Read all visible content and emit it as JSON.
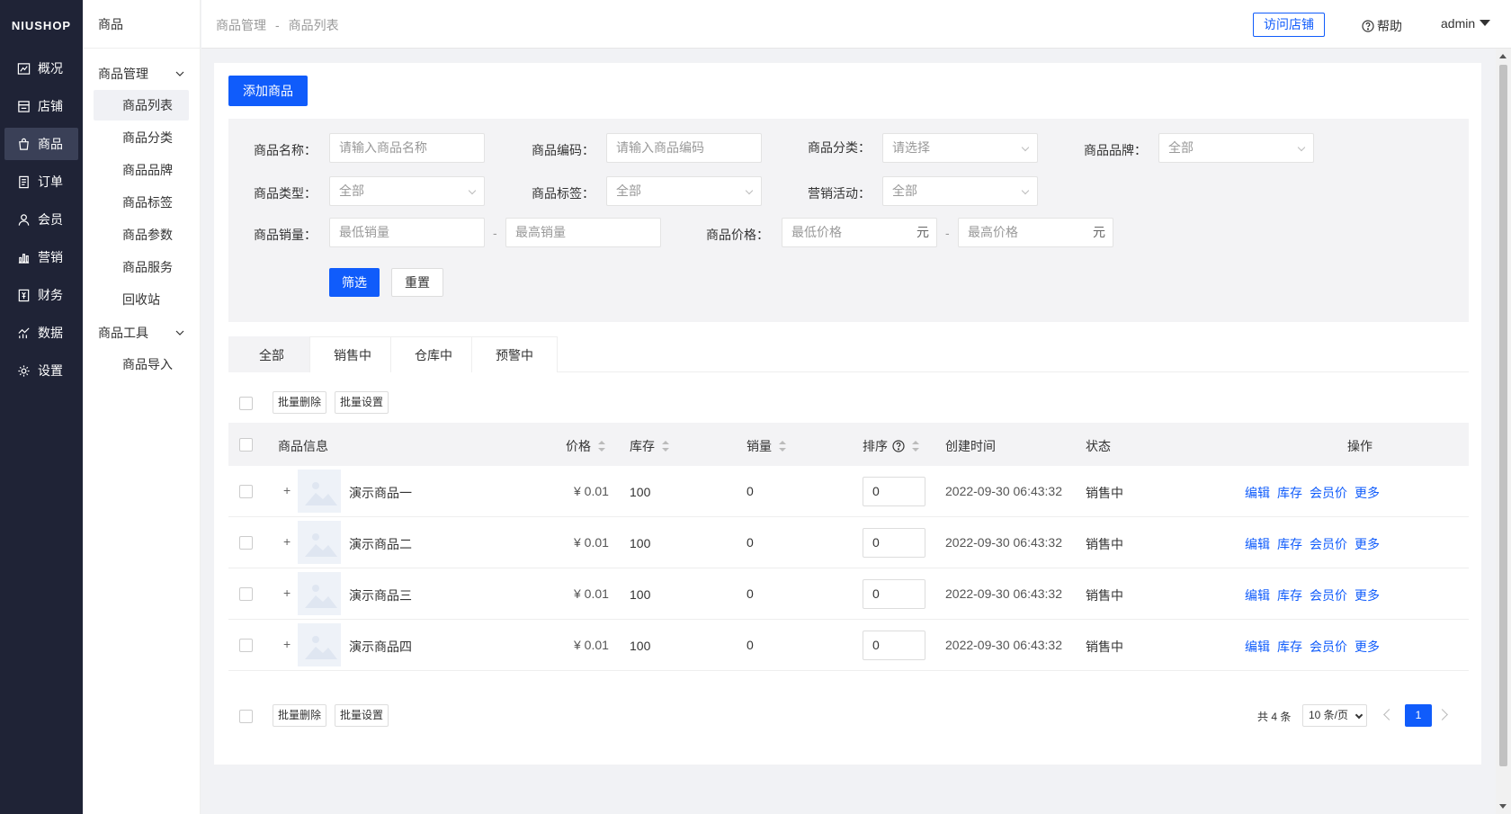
{
  "app": {
    "logo": "NIUSHOP"
  },
  "sidebar": {
    "items": [
      {
        "label": "概况",
        "icon": "chart-icon"
      },
      {
        "label": "店铺",
        "icon": "store-icon"
      },
      {
        "label": "商品",
        "icon": "goods-icon"
      },
      {
        "label": "订单",
        "icon": "order-icon"
      },
      {
        "label": "会员",
        "icon": "member-icon"
      },
      {
        "label": "营销",
        "icon": "marketing-icon"
      },
      {
        "label": "财务",
        "icon": "finance-icon"
      },
      {
        "label": "数据",
        "icon": "data-icon"
      },
      {
        "label": "设置",
        "icon": "settings-icon"
      }
    ]
  },
  "subnav": {
    "title": "商品",
    "group1": "商品管理",
    "group1_items": [
      "商品列表",
      "商品分类",
      "商品品牌",
      "商品标签",
      "商品参数",
      "商品服务",
      "回收站"
    ],
    "group2": "商品工具",
    "group2_items": [
      "商品导入"
    ]
  },
  "header": {
    "breadcrumb": [
      "商品管理",
      "商品列表"
    ],
    "breadcrumb_sep": "-",
    "visit_store": "访问店铺",
    "help": "帮助",
    "user": "admin"
  },
  "toolbar": {
    "add_goods": "添加商品"
  },
  "filters": {
    "name_label": "商品名称：",
    "name_placeholder": "请输入商品名称",
    "code_label": "商品编码：",
    "code_placeholder": "请输入商品编码",
    "category_label": "商品分类：",
    "category_value": "请选择",
    "brand_label": "商品品牌：",
    "brand_value": "全部",
    "type_label": "商品类型：",
    "type_value": "全部",
    "tag_label": "商品标签：",
    "tag_value": "全部",
    "activity_label": "营销活动：",
    "activity_value": "全部",
    "sales_label": "商品销量：",
    "sales_min": "最低销量",
    "sales_max": "最高销量",
    "price_label": "商品价格：",
    "price_min": "最低价格",
    "price_max": "最高价格",
    "unit": "元",
    "dash": "-",
    "filter_btn": "筛选",
    "reset_btn": "重置"
  },
  "tabs": [
    "全部",
    "销售中",
    "仓库中",
    "预警中"
  ],
  "batch": {
    "delete": "批量删除",
    "set": "批量设置"
  },
  "table": {
    "headers": {
      "info": "商品信息",
      "price": "价格",
      "stock": "库存",
      "sales": "销量",
      "sort": "排序",
      "created": "创建时间",
      "status": "状态",
      "ops": "操作"
    },
    "rows": [
      {
        "name": "演示商品一",
        "price": "¥ 0.01",
        "stock": "100",
        "sales": "0",
        "sort": "0",
        "created": "2022-09-30 06:43:32",
        "status": "销售中"
      },
      {
        "name": "演示商品二",
        "price": "¥ 0.01",
        "stock": "100",
        "sales": "0",
        "sort": "0",
        "created": "2022-09-30 06:43:32",
        "status": "销售中"
      },
      {
        "name": "演示商品三",
        "price": "¥ 0.01",
        "stock": "100",
        "sales": "0",
        "sort": "0",
        "created": "2022-09-30 06:43:32",
        "status": "销售中"
      },
      {
        "name": "演示商品四",
        "price": "¥ 0.01",
        "stock": "100",
        "sales": "0",
        "sort": "0",
        "created": "2022-09-30 06:43:32",
        "status": "销售中"
      }
    ],
    "ops": [
      "编辑",
      "库存",
      "会员价",
      "更多"
    ],
    "expand": "+"
  },
  "pagination": {
    "total": "共 4 条",
    "page_size": "10 条/页",
    "current": "1"
  },
  "colors": {
    "primary": "#105cfb",
    "sidebar_bg": "#1f2336"
  }
}
